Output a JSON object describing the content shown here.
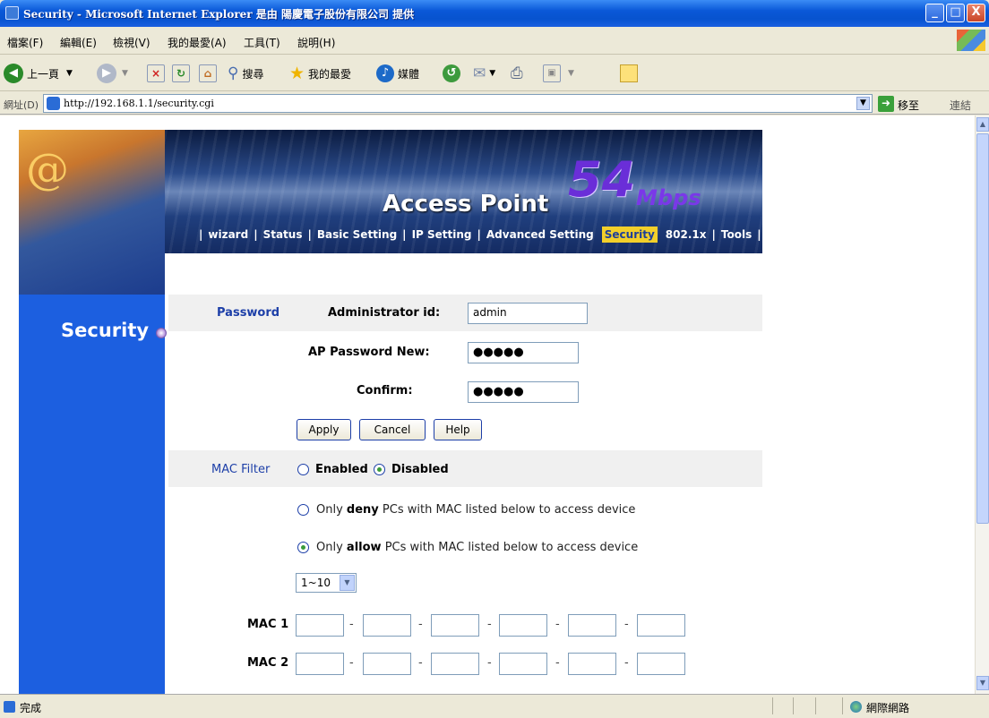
{
  "window": {
    "title": "Security - Microsoft Internet Explorer 是由 陽慶電子股份有限公司 提供",
    "controls": {
      "minimize": "_",
      "maximize": "□",
      "close": "X"
    }
  },
  "menu": [
    "檔案(F)",
    "編輯(E)",
    "檢視(V)",
    "我的最愛(A)",
    "工具(T)",
    "說明(H)"
  ],
  "toolbar": {
    "back": "上一頁",
    "search": "搜尋",
    "favorites": "我的最愛",
    "media": "媒體"
  },
  "address": {
    "label": "網址(D)",
    "url": "http://192.168.1.1/security.cgi",
    "go": "移至",
    "links": "連結"
  },
  "banner": {
    "name_a": "Access",
    "name_b": "Point",
    "speed": "54",
    "unit": "Mbps"
  },
  "nav": [
    {
      "label": "wizard",
      "active": false
    },
    {
      "label": "Status",
      "active": false
    },
    {
      "label": "Basic  Setting",
      "active": false
    },
    {
      "label": "IP Setting",
      "active": false
    },
    {
      "label": "Advanced Setting",
      "active": false
    },
    {
      "label": "Security",
      "active": true
    },
    {
      "label": "802.1x",
      "active": false
    },
    {
      "label": "Tools",
      "active": false
    }
  ],
  "sidebar": {
    "section": "Security"
  },
  "password": {
    "section": "Password",
    "admin_label": "Administrator id:",
    "admin_value": "admin",
    "new_label": "AP Password New:",
    "new_value": "●●●●●",
    "confirm_label": "Confirm:",
    "confirm_value": "●●●●●",
    "apply": "Apply",
    "cancel": "Cancel",
    "help": "Help"
  },
  "mac_filter": {
    "label": "MAC Filter",
    "enabled": "Enabled",
    "disabled": "Disabled",
    "state": "disabled",
    "deny_pre": "Only ",
    "deny_bold": "deny",
    "deny_post": " PCs with MAC listed below to access device",
    "allow_pre": "Only ",
    "allow_bold": "allow",
    "allow_post": " PCs with MAC listed below to access device",
    "mode": "allow",
    "range": "1~10",
    "rows": [
      {
        "label": "MAC 1",
        "octets": [
          "",
          "",
          "",
          "",
          "",
          ""
        ]
      },
      {
        "label": "MAC 2",
        "octets": [
          "",
          "",
          "",
          "",
          "",
          ""
        ]
      }
    ]
  },
  "status": {
    "text": "完成",
    "zone": "網際網路"
  }
}
